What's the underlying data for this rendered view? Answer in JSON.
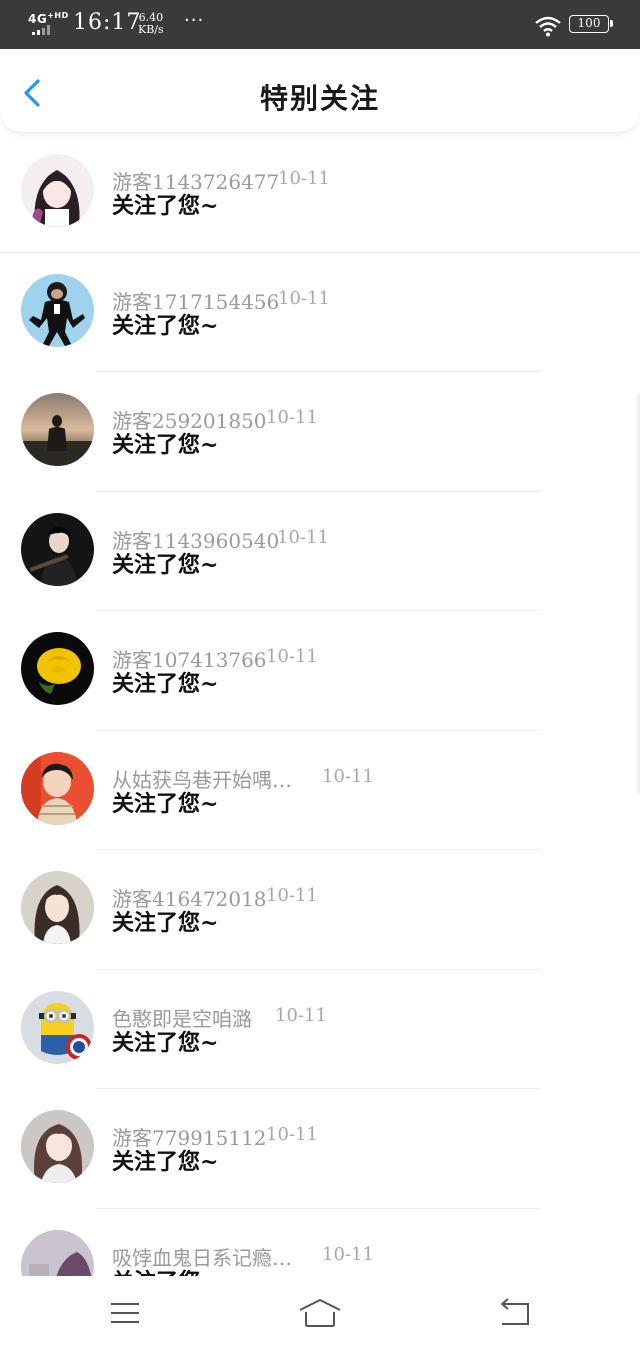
{
  "status_bar": {
    "network": "4G",
    "network_sup": "+HD",
    "time": "16:17",
    "speed_value": "6.40",
    "speed_unit": "KB/s",
    "dots": "···",
    "battery": "100"
  },
  "header": {
    "title": "特别关注",
    "back_icon": "chevron-left-icon",
    "accent_color": "#2196F3"
  },
  "follows": [
    {
      "name": "游客1143726477",
      "date": "10-11",
      "message": "关注了您~",
      "avatar": "anime-girl-avatar"
    },
    {
      "name": "游客1717154456",
      "date": "10-11",
      "message": "关注了您~",
      "avatar": "monkey-avatar"
    },
    {
      "name": "游客259201850",
      "date": "10-11",
      "message": "关注了您~",
      "avatar": "sunset-figure-avatar"
    },
    {
      "name": "游客1143960540",
      "date": "10-11",
      "message": "关注了您~",
      "avatar": "dark-portrait-avatar"
    },
    {
      "name": "游客107413766",
      "date": "10-11",
      "message": "关注了您~",
      "avatar": "yellow-rose-avatar"
    },
    {
      "name": "从姑获鸟巷开始喁…",
      "date": "10-11",
      "message": "关注了您~",
      "avatar": "child-avatar"
    },
    {
      "name": "游客416472018",
      "date": "10-11",
      "message": "关注了您~",
      "avatar": "girl-portrait-avatar"
    },
    {
      "name": "色憨即是空咱潞",
      "date": "10-11",
      "message": "关注了您~",
      "avatar": "minion-avatar"
    },
    {
      "name": "游客779915112",
      "date": "10-11",
      "message": "关注了您~",
      "avatar": "girl-photo-avatar"
    },
    {
      "name": "吸饽血鬼日系记瘾…",
      "date": "10-11",
      "message": "关注了您~",
      "avatar": "partial-avatar"
    }
  ],
  "bottom_nav": {
    "menu_icon": "menu-icon",
    "home_icon": "home-icon",
    "back_icon": "back-icon"
  }
}
